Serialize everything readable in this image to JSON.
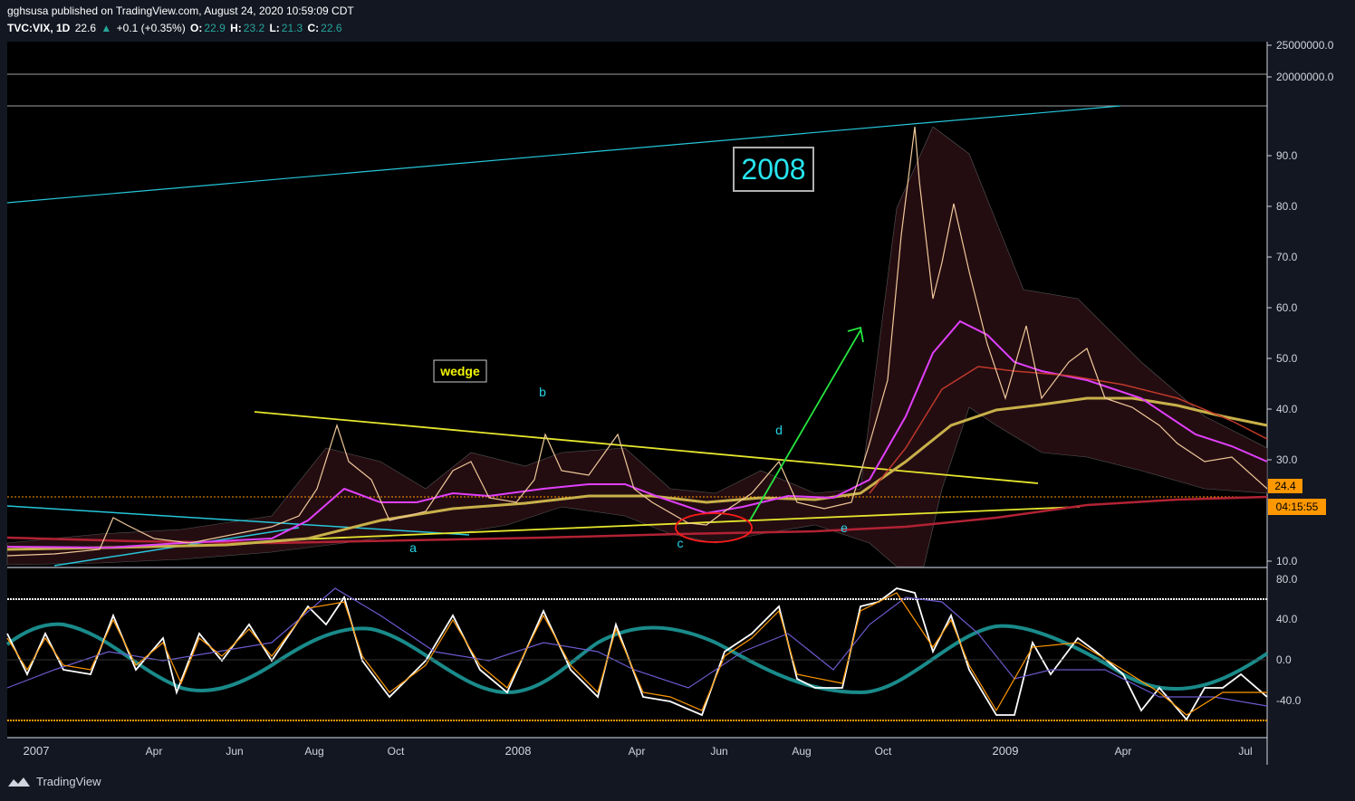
{
  "header": {
    "publish_line": "gghsusa published on TradingView.com, August 24, 2020 10:59:09 CDT",
    "symbol": "TVC:VIX, 1D",
    "last": "22.6",
    "change": "+0.1 (+0.35%)",
    "o_label": "O:",
    "o_val": "22.9",
    "h_label": "H:",
    "h_val": "23.2",
    "l_label": "L:",
    "l_val": "21.3",
    "c_label": "C:",
    "c_val": "22.6"
  },
  "footer": {
    "brand": "TradingView"
  },
  "colors": {
    "background": "#131722",
    "trendline_cyan": "#26c6da",
    "wedge_yellow": "#e6e62e",
    "ma_magenta": "#e040fb",
    "ma_dark_red": "#b22234",
    "ma_gold": "#c8b04a",
    "arrow_green": "#26e640",
    "price_label_bg": "#ff9800",
    "oscillator_teal": "#1a8a8a"
  },
  "annotations": {
    "year_box": "2008",
    "wedge_label": "wedge",
    "points": [
      "a",
      "b",
      "c",
      "d",
      "e"
    ]
  },
  "chart_data": [
    {
      "type": "line",
      "title": "",
      "symbol": "TVC:VIX",
      "scale": "log",
      "y_ticks": [
        "25000000.0",
        "20000000.0",
        "90.0",
        "80.0",
        "70.0",
        "60.0",
        "50.0",
        "40.0",
        "30.0",
        "10.0"
      ],
      "x_ticks": [
        "2007",
        "Apr",
        "Jun",
        "Aug",
        "Oct",
        "2008",
        "Apr",
        "Jun",
        "Aug",
        "Oct",
        "2009",
        "Apr",
        "Jul"
      ],
      "price_label": "24.4",
      "countdown_label": "04:15:55",
      "series": [
        {
          "x": [
            "2007-01",
            "2007-03",
            "2007-04",
            "2007-06",
            "2007-07",
            "2007-08",
            "2007-09",
            "2007-10",
            "2007-11",
            "2007-12",
            "2008-01",
            "2008-02",
            "2008-03",
            "2008-04",
            "2008-05",
            "2008-06",
            "2008-07",
            "2008-08",
            "2008-09",
            "2008-10",
            "2008-11",
            "2008-12",
            "2009-01",
            "2009-02",
            "2009-03",
            "2009-04",
            "2009-05",
            "2009-06",
            "2009-07"
          ],
          "values": [
            11,
            13,
            15,
            14,
            16,
            30,
            24,
            19,
            25,
            22,
            26,
            28,
            30,
            22,
            18,
            23,
            27,
            21,
            29,
            65,
            67,
            50,
            45,
            46,
            46,
            40,
            32,
            28,
            26
          ]
        }
      ]
    },
    {
      "type": "line",
      "title": "",
      "y_ticks": [
        "80.0",
        "40.0",
        "0.0",
        "-40.0"
      ],
      "series": [
        {
          "x": [
            "2007-01",
            "2007-03",
            "2007-04",
            "2007-06",
            "2007-07",
            "2007-08",
            "2007-09",
            "2007-10",
            "2007-11",
            "2007-12",
            "2008-01",
            "2008-02",
            "2008-03",
            "2008-04",
            "2008-05",
            "2008-06",
            "2008-07",
            "2008-08",
            "2008-09",
            "2008-10",
            "2008-11",
            "2008-12",
            "2009-01",
            "2009-02",
            "2009-03",
            "2009-04",
            "2009-05",
            "2009-06",
            "2009-07"
          ],
          "values": [
            20,
            40,
            -30,
            10,
            40,
            60,
            10,
            -30,
            50,
            -20,
            -30,
            60,
            40,
            -30,
            -50,
            40,
            60,
            -20,
            -30,
            70,
            40,
            -40,
            -50,
            10,
            20,
            -20,
            -40,
            -30,
            10
          ]
        }
      ]
    }
  ]
}
